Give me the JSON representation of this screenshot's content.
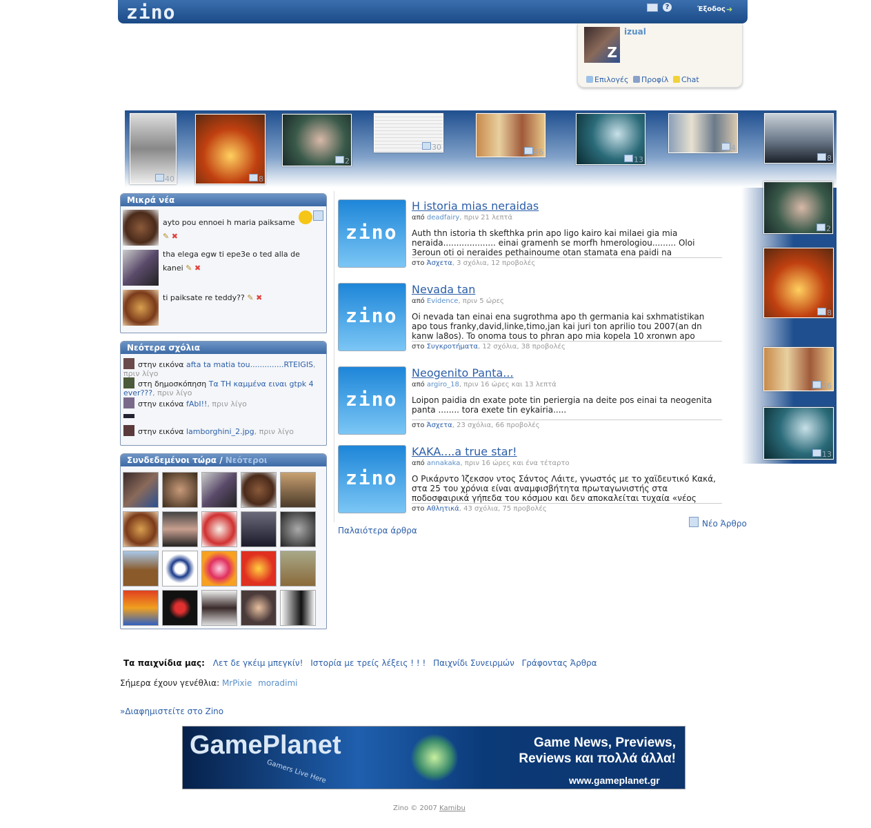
{
  "header": {
    "logo": "zino",
    "logout": "Έξοδος"
  },
  "user": {
    "name": "izual",
    "avatar_letter": "Z",
    "options": "Επιλογές",
    "profile": "Προφίλ",
    "chat": "Chat"
  },
  "photo_strip": [
    {
      "count": "40"
    },
    {
      "count": "8"
    },
    {
      "count": "2"
    },
    {
      "count": "30"
    },
    {
      "count": "46"
    },
    {
      "count": "13"
    },
    {
      "count": "4"
    },
    {
      "count": "8"
    }
  ],
  "photo_column": [
    {
      "count": "2"
    },
    {
      "count": "8"
    },
    {
      "count": "46"
    },
    {
      "count": "13"
    }
  ],
  "shoutbox": {
    "title": "Μικρά νέα",
    "items": [
      {
        "text": "ayto pou ennoei h maria paiksame"
      },
      {
        "text": "tha elega egw ti epe3e o ted alla de kanei"
      },
      {
        "text": "ti paiksate re teddy??"
      }
    ]
  },
  "comments": {
    "title": "Νεότερα σχόλια",
    "items": [
      {
        "prefix": "στην εικόνα",
        "link": "afta ta matia tou..............RTEIGIS",
        "ago": ", πριν λίγο"
      },
      {
        "prefix": "στη δημοσκόπηση",
        "link": "Τα ΤΗ καμμένα ειναι gtpk 4 ever???",
        "ago": ", πριν λίγο"
      },
      {
        "prefix": "στην εικόνα",
        "link": "fAbI!!",
        "ago": ", πριν λίγο"
      },
      {
        "prefix": "στην εικόνα",
        "link": "lamborghini_2.jpg",
        "ago": ", πριν λίγο"
      }
    ]
  },
  "online": {
    "title": "Συνδεδεμένοι τώρα",
    "separator": "/",
    "newest": "Νεότεροι"
  },
  "articles": [
    {
      "title": "H istoria mias neraidas",
      "by": "από",
      "author": "deadfairy",
      "time": ", πριν 21 λεπτά",
      "body": "Auth thn istoria th skefthka prin apo ligo kairo kai milaei gia mia neraida.................... einai gramenh se morfh hmerologiou......... Oloi 3eroun oti oi neraides pethainoume otan stamata ena paidi na",
      "in": "στο",
      "category": "Άσχετα",
      "stats": ", 3 σχόλια, 12 προβολές"
    },
    {
      "title": "Nevada tan",
      "by": "από",
      "author": "Evidence",
      "time": ", πριν 5 ώρες",
      "body": "Oi nevada tan einai ena sugrothma apo th germania kai sxhmatistikan apo tous franky,david,linke,timo,jan kai juri ton aprilio tou 2007(an dn kanw la8os). To onoma tous to phran apo mia kopela 10 xronwn apo",
      "in": "στο",
      "category": "Συγκροτήματα",
      "stats": ", 12 σχόλια, 38 προβολές"
    },
    {
      "title": "Neogenito Panta...",
      "by": "από",
      "author": "argiro_18",
      "time": ", πριν 16 ώρες και 13 λεπτά",
      "body": "Loipon paidia dn exate pote tin periergia na deite pos einai ta neogenita panta ........ tora exete tin eykairia.....",
      "in": "στο",
      "category": "Άσχετα",
      "stats": ", 23 σχόλια, 66 προβολές"
    },
    {
      "title": "KAKA....a true star!",
      "by": "από",
      "author": "annakaka",
      "time": ", πριν 16 ώρες και ένα τέταρτο",
      "body": "Ο Ρικάρντο Ίζεκσον ντος Σάντος Λάιτε, γνωστός με το χαϊδευτικό Κακά, στα 25 του χρόνια είναι αναμφισβήτητα πρωταγωνιστής στα ποδοσφαιρικά γήπεδα του κόσμου και δεν αποκαλείται τυχαία «νέος",
      "in": "στο",
      "category": "Αθλητικά",
      "stats": ", 43 σχόλια, 75 προβολές"
    }
  ],
  "article_logo": "zino",
  "new_article": "Νέο Άρθρο",
  "older_articles": "Παλαιότερα άρθρα",
  "games": {
    "label": "Τα παιχνίδια μας:",
    "items": [
      "Λετ δε γκέιμ μπεγκίν!",
      "Ιστορία με τρείς λέξεις ! ! !",
      "Παιχνίδι Συνειρμών",
      "Γράφοντας Άρθρα"
    ]
  },
  "birthdays": {
    "label": "Σήμερα έχουν γενέθλια:",
    "users": [
      "MrPixie",
      "moradimi"
    ]
  },
  "advertise": "»Διαφημιστείτε στο Zino",
  "banner": {
    "title": "GamePlanet",
    "tagline": "Gamers Live Here",
    "line1": "Game News, Previews,",
    "line2": "Reviews και πολλά άλλα!",
    "url": "www.gameplanet.gr"
  },
  "footer": {
    "text": "Zino © 2007",
    "link": "Kamibu"
  }
}
